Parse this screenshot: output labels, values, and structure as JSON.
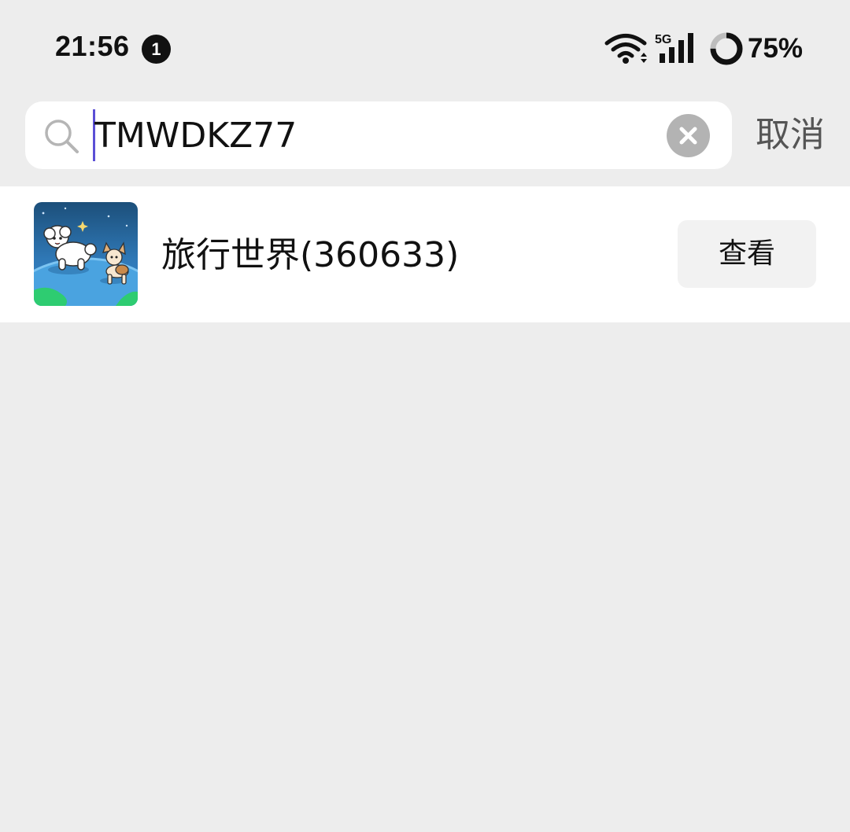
{
  "status_bar": {
    "time": "21:56",
    "notification_count": "1",
    "network": "5G",
    "battery_percent": "75%",
    "battery_level": 0.75
  },
  "search": {
    "query": "TMWDKZ77",
    "cancel_label": "取消"
  },
  "results": [
    {
      "title": "旅行世界(360633)",
      "action_label": "查看"
    }
  ],
  "colors": {
    "background": "#ededed",
    "caret": "#5b4fd6",
    "clear_button": "#b3b3b3",
    "view_button_bg": "#f2f2f2"
  },
  "icons": {
    "search": "search-icon",
    "clear": "clear-icon",
    "wifi": "wifi-icon",
    "signal": "signal-icon",
    "battery": "battery-icon"
  }
}
